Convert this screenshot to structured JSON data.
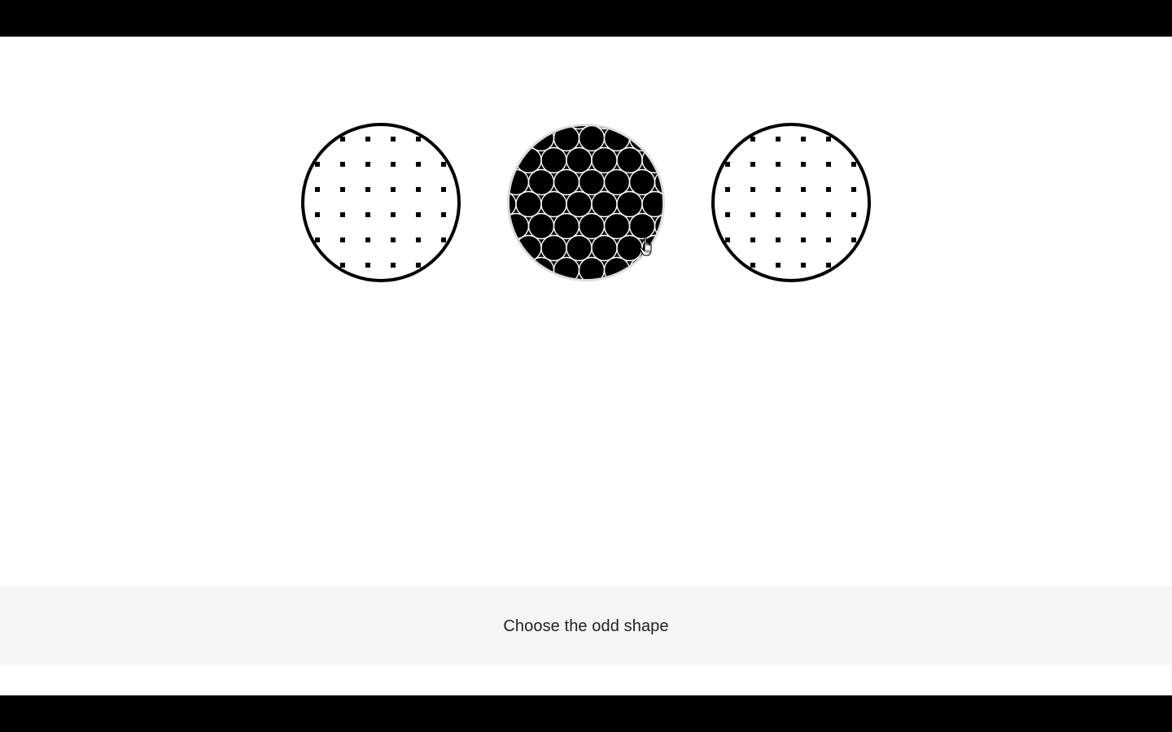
{
  "prompt": {
    "text": "Choose the odd shape"
  },
  "choices": [
    {
      "pattern": "dots-on-white",
      "state": "default"
    },
    {
      "pattern": "white-circles-on-black",
      "state": "hovered"
    },
    {
      "pattern": "dots-on-white",
      "state": "default"
    }
  ],
  "colors": {
    "letterbox": "#000000",
    "background": "#ffffff",
    "instruction_bar": "#f5f5f5",
    "shape_stroke": "#000000",
    "hover_ring": "#dddddd"
  },
  "icons": {
    "cursor": "hand-pointer-icon"
  }
}
